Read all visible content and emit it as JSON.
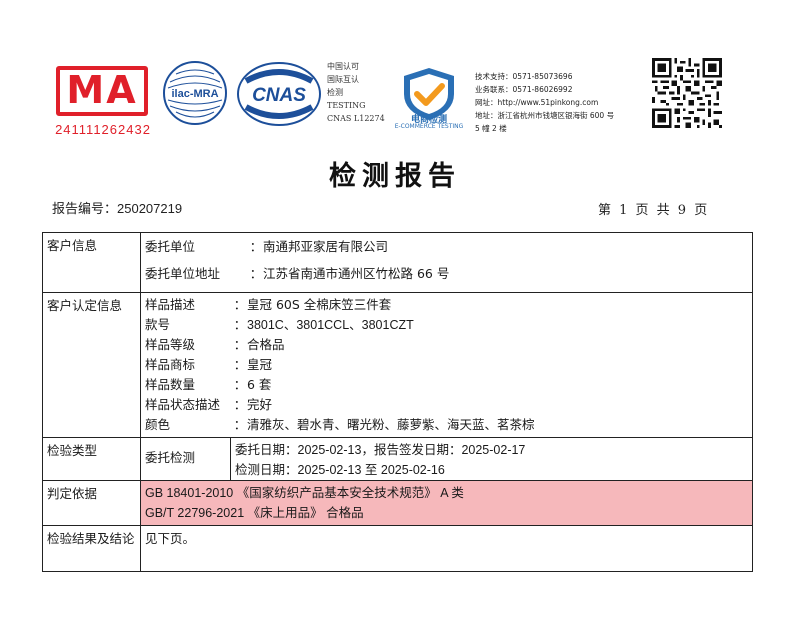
{
  "logos": {
    "ma_text": "MA",
    "ma_number": "241111262432",
    "ilac_text": "ilac-MRA",
    "cnas_text": "CNAS",
    "cnas_caption": [
      "中国认可",
      "国际互认",
      "检测",
      "TESTING",
      "CNAS L12274"
    ],
    "eshop_title": "电商检测",
    "eshop_sub": "E-COMMERCE TESTING",
    "colors": {
      "ma_red": "#e0202a",
      "cnas_blue": "#1d4f9a",
      "eshop_blue": "#2a6fb5",
      "check_orange": "#f39a1e"
    }
  },
  "contact": {
    "tech_support": "技术支持：0571-85073696",
    "business": "业务联系：0571-86026992",
    "website": "网址：http://www.51pinkong.com",
    "address_1": "地址：浙江省杭州市钱塘区银海街 600 号",
    "address_2": "5 幢 2 楼"
  },
  "title": "检测报告",
  "report_number_label": "报告编号：",
  "report_number": "250207219",
  "page_info": "第 1 页 共 9 页",
  "customer_info": {
    "category": "客户信息",
    "rows": [
      {
        "label": "委托单位",
        "value": "南通邦亚家居有限公司"
      },
      {
        "label": "委托单位地址",
        "value": "江苏省南通市通州区竹松路 66 号"
      }
    ]
  },
  "customer_confirmed": {
    "category": "客户认定信息",
    "rows": [
      {
        "label": "样品描述",
        "value": "皇冠 60S 全棉床笠三件套"
      },
      {
        "label": "款号",
        "value": "3801C、3801CCL、3801CZT"
      },
      {
        "label": "样品等级",
        "value": "合格品"
      },
      {
        "label": "样品商标",
        "value": "皇冠"
      },
      {
        "label": "样品数量",
        "value": "6 套"
      },
      {
        "label": "样品状态描述",
        "value": "完好"
      },
      {
        "label": "颜色",
        "value": "清雅灰、碧水青、曙光粉、藤萝紫、海天蓝、茗茶棕"
      }
    ]
  },
  "inspection_type": {
    "category": "检验类型",
    "type": "委托检测",
    "line1": "委托日期：2025-02-13，报告签发日期：2025-02-17",
    "line2": "检测日期：2025-02-13 至 2025-02-16"
  },
  "basis": {
    "category": "判定依据",
    "line1": "GB 18401-2010 《国家纺织产品基本安全技术规范》 A 类",
    "line2": "GB/T 22796-2021 《床上用品》 合格品",
    "highlight_color": "#f6b8bb"
  },
  "result": {
    "category": "检验结果及结论",
    "value": "见下页。"
  }
}
